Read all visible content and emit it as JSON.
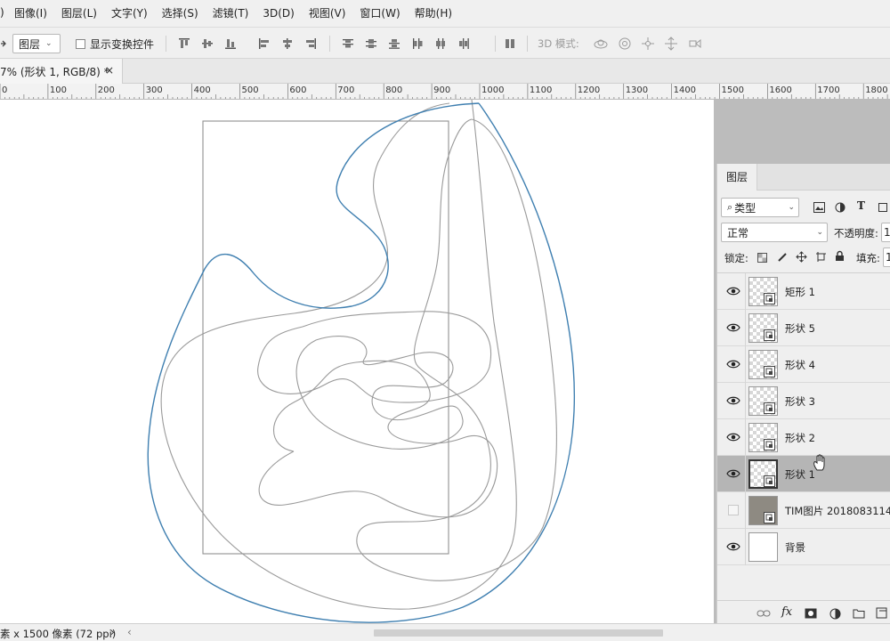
{
  "menu": {
    "items": [
      "图像(I)",
      "图层(L)",
      "文字(Y)",
      "选择(S)",
      "滤镜(T)",
      "3D(D)",
      "视图(V)",
      "窗口(W)",
      "帮助(H)"
    ]
  },
  "options_bar": {
    "select_value": "图层",
    "show_transform_label": "显示变换控件",
    "mode_3d_label": "3D 模式:"
  },
  "document_tab": {
    "title": "7% (形状 1, RGB/8) *",
    "close_glyph": "×"
  },
  "ruler": {
    "labels": [
      "0",
      "100",
      "200",
      "300",
      "400",
      "500",
      "600",
      "700",
      "800",
      "900",
      "1000",
      "1100",
      "1200",
      "1300",
      "1400",
      "1500",
      "1600",
      "1700",
      "1800"
    ]
  },
  "layers_panel": {
    "tab_label": "图层",
    "filter_value": "类型",
    "blend_mode": "正常",
    "opacity_label": "不透明度:",
    "opacity_value": "1",
    "lock_label": "锁定:",
    "fill_label": "填充:",
    "fill_value": "1",
    "layers": [
      {
        "name": "矩形 1",
        "visible": true,
        "thumb": "transparent",
        "badge": true,
        "selected": false
      },
      {
        "name": "形状 5",
        "visible": true,
        "thumb": "transparent",
        "badge": true,
        "selected": false
      },
      {
        "name": "形状 4",
        "visible": true,
        "thumb": "transparent",
        "badge": true,
        "selected": false
      },
      {
        "name": "形状 3",
        "visible": true,
        "thumb": "transparent",
        "badge": true,
        "selected": false
      },
      {
        "name": "形状 2",
        "visible": true,
        "thumb": "transparent",
        "badge": true,
        "selected": false
      },
      {
        "name": "形状 1",
        "visible": true,
        "thumb": "transparent",
        "badge": true,
        "selected": true
      },
      {
        "name": "TIM图片 2018083114...",
        "visible": false,
        "thumb": "photo",
        "badge": true,
        "selected": false
      },
      {
        "name": "背景",
        "visible": true,
        "thumb": "white",
        "badge": false,
        "selected": false
      }
    ]
  },
  "status": {
    "text": "素 x 1500 像素 (72 ppi)",
    "arrow": "›",
    "left_arrow": "‹"
  },
  "colors": {
    "path_selected": "#3f7fb0",
    "path_other": "#9a9a9a",
    "selected_layer": "#b5b5b5"
  }
}
